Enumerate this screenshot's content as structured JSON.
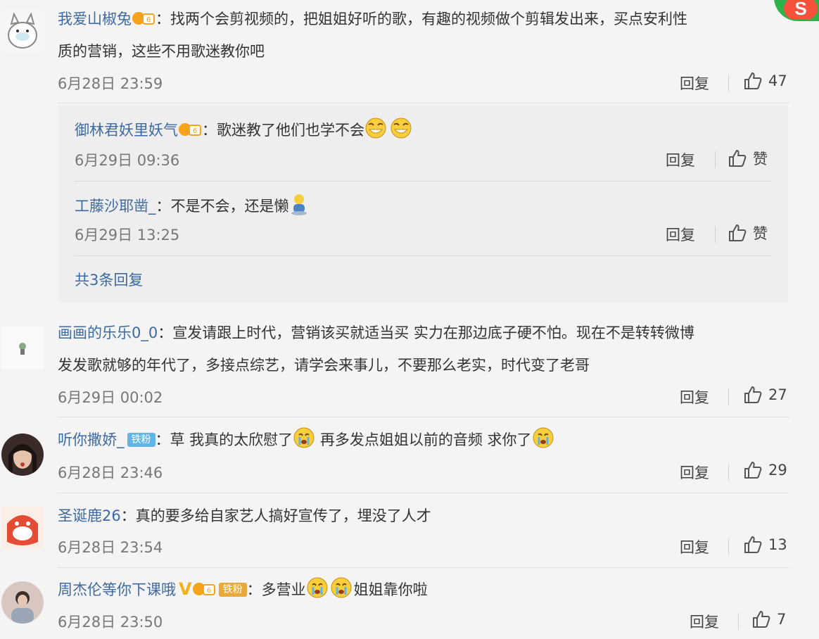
{
  "reply_label": "回复",
  "like_word": "赞",
  "comments": [
    {
      "user": "我爱山椒兔",
      "text": "：找两个会剪视频的，把姐姐好听的歌，有趣的视频做个剪辑发出来，买点安利性",
      "text2": "质的营销，这些不用歌迷教你吧",
      "time": "6月28日 23:59",
      "likes": "47"
    },
    {
      "user": "画画的乐乐0_0",
      "text": "：宣发请跟上时代，营销该买就适当买 实力在那边底子硬不怕。现在不是转转微博",
      "text2": "发发歌就够的年代了，多接点综艺，请学会来事儿，不要那么老实，时代变了老哥",
      "time": "6月29日 00:02",
      "likes": "27"
    },
    {
      "user": "听你撒娇_",
      "badge": "铁粉",
      "text_a": "：草 我真的太欣慰了",
      "text_b": " 再多发点姐姐以前的音频 求你了",
      "time": "6月28日 23:46",
      "likes": "29"
    },
    {
      "user": "圣诞鹿26",
      "text": "：真的要多给自家艺人搞好宣传了，埋没了人才",
      "time": "6月28日 23:54",
      "likes": "13"
    },
    {
      "user": "周杰伦等你下课哦",
      "badge": "铁粉",
      "text_a": "：多营业",
      "text_b": "姐姐靠你啦",
      "time": "6月28日 23:50",
      "likes": "7"
    }
  ],
  "replies": [
    {
      "user": "御林君妖里妖气",
      "text": "：歌迷教了他们也学不会",
      "time": "6月29日 09:36"
    },
    {
      "user": "工藤沙耶凿_",
      "text": "：不是不会，还是懒",
      "time": "6月29日 13:25"
    }
  ],
  "more_replies": "共3条回复",
  "colors": {
    "link": "#3d6aa1",
    "background": "#f4f4f4",
    "reply_box": "#eeeeee"
  }
}
